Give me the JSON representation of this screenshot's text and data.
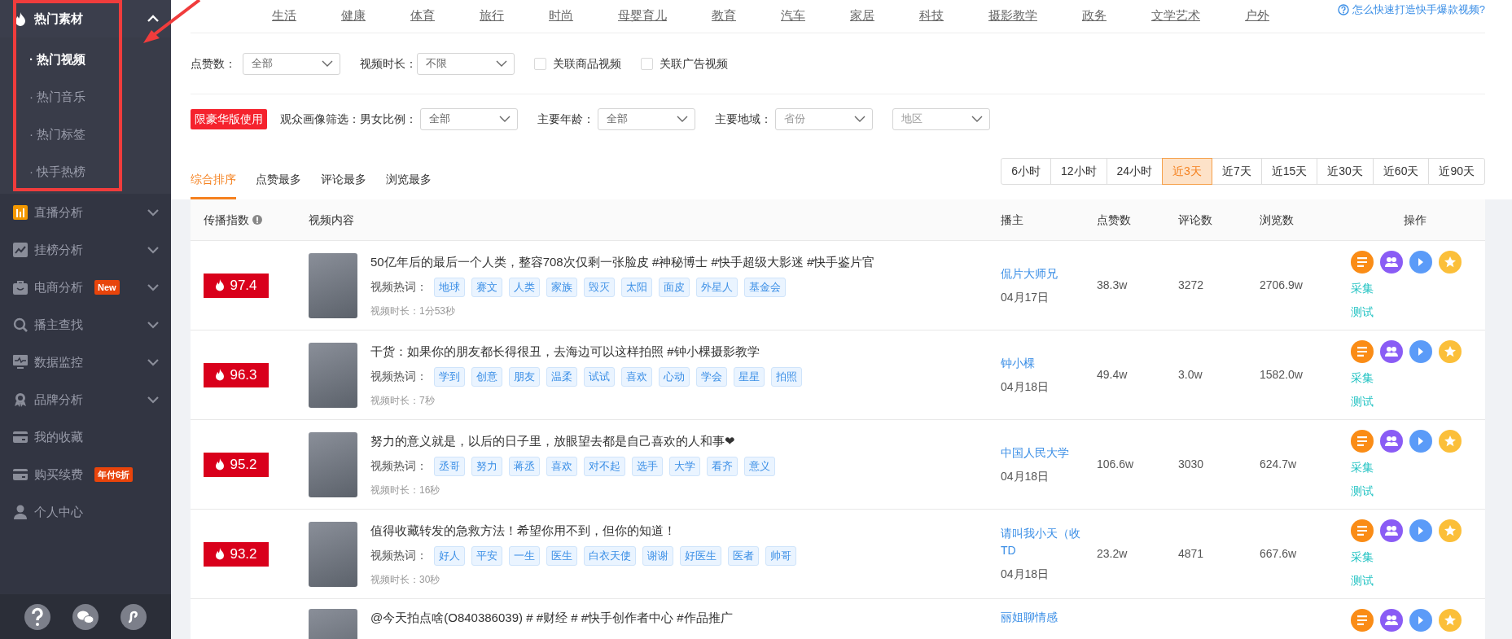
{
  "sidebar": {
    "items": [
      {
        "label": "热门素材",
        "expanded": true,
        "children": [
          {
            "label": "· 热门视频",
            "selected": true
          },
          {
            "label": "· 热门音乐",
            "selected": false
          },
          {
            "label": "· 热门标签",
            "selected": false
          },
          {
            "label": "· 快手热榜",
            "selected": false
          }
        ]
      },
      {
        "label": "直播分析",
        "expanded": false
      },
      {
        "label": "挂榜分析",
        "expanded": false
      },
      {
        "label": "电商分析",
        "badge": "New",
        "expanded": false
      },
      {
        "label": "播主查找",
        "expanded": false
      },
      {
        "label": "数据监控",
        "expanded": false
      },
      {
        "label": "品牌分析",
        "expanded": false
      },
      {
        "label": "我的收藏"
      },
      {
        "label": "购买续费",
        "badge": "年付6折"
      },
      {
        "label": "个人中心"
      }
    ]
  },
  "categories": [
    "生活",
    "健康",
    "体育",
    "旅行",
    "时尚",
    "母婴育儿",
    "教育",
    "汽车",
    "家居",
    "科技",
    "摄影教学",
    "政务",
    "文学艺术",
    "户外"
  ],
  "help_link": "怎么快速打造快手爆款视频?",
  "filters": {
    "likes": {
      "label": "点赞数：",
      "value": "全部"
    },
    "duration": {
      "label": "视频时长：",
      "value": "不限"
    },
    "checkboxes": [
      {
        "label": "关联商品视频",
        "checked": false
      },
      {
        "label": "关联广告视频",
        "checked": false
      }
    ]
  },
  "audience": {
    "badge": "限豪华版使用",
    "label": "观众画像筛选：",
    "selects": [
      {
        "label": "男女比例：",
        "value": "全部"
      },
      {
        "label": "主要年龄：",
        "value": "全部"
      },
      {
        "label": "主要地域：",
        "placeholder": "省份"
      },
      {
        "placeholder": "地区"
      }
    ]
  },
  "sort_tabs": [
    {
      "label": "综合排序",
      "selected": true
    },
    {
      "label": "点赞最多",
      "selected": false
    },
    {
      "label": "评论最多",
      "selected": false
    },
    {
      "label": "浏览最多",
      "selected": false
    }
  ],
  "time_ranges": [
    {
      "label": "6小时",
      "selected": false
    },
    {
      "label": "12小时",
      "selected": false
    },
    {
      "label": "24小时",
      "selected": false
    },
    {
      "label": "近3天",
      "selected": true
    },
    {
      "label": "近7天",
      "selected": false
    },
    {
      "label": "近15天",
      "selected": false
    },
    {
      "label": "近30天",
      "selected": false
    },
    {
      "label": "近60天",
      "selected": false
    },
    {
      "label": "近90天",
      "selected": false
    }
  ],
  "table": {
    "columns": [
      "传播指数",
      "视频内容",
      "播主",
      "点赞数",
      "评论数",
      "浏览数",
      "操作"
    ],
    "rows": [
      {
        "score": "97.4",
        "title": "50亿年后的最后一个人类，整容708次仅剩一张脸皮 #神秘博士 #快手超级大影迷 #快手鉴片官",
        "keywords_label": "视频热词：",
        "keywords": [
          "地球",
          "赛文",
          "人类",
          "家族",
          "毁灭",
          "太阳",
          "面皮",
          "外星人",
          "基金会"
        ],
        "duration": "视频时长：1分53秒",
        "author": "侃片大师兄",
        "date": "04月17日",
        "likes": "38.3w",
        "comments": "3272",
        "views": "2706.9w",
        "links": [
          "采集",
          "测试"
        ]
      },
      {
        "score": "96.3",
        "title": "干货：如果你的朋友都长得很丑，去海边可以这样拍照 #钟小棵摄影教学",
        "keywords_label": "视频热词：",
        "keywords": [
          "学到",
          "创意",
          "朋友",
          "温柔",
          "试试",
          "喜欢",
          "心动",
          "学会",
          "星星",
          "拍照"
        ],
        "duration": "视频时长：7秒",
        "author": "钟小棵",
        "date": "04月18日",
        "likes": "49.4w",
        "comments": "3.0w",
        "views": "1582.0w",
        "links": [
          "采集",
          "测试"
        ]
      },
      {
        "score": "95.2",
        "title": "努力的意义就是，以后的日子里，放眼望去都是自己喜欢的人和事❤",
        "keywords_label": "视频热词：",
        "keywords": [
          "丞哥",
          "努力",
          "蒋丞",
          "喜欢",
          "对不起",
          "选手",
          "大学",
          "看齐",
          "意义"
        ],
        "duration": "视频时长：16秒",
        "author": "中国人民大学",
        "date": "04月18日",
        "likes": "106.6w",
        "comments": "3030",
        "views": "624.7w",
        "links": [
          "采集",
          "测试"
        ]
      },
      {
        "score": "93.2",
        "title": "值得收藏转发的急救方法！希望你用不到，但你的知道！",
        "keywords_label": "视频热词：",
        "keywords": [
          "好人",
          "平安",
          "一生",
          "医生",
          "白衣天使",
          "谢谢",
          "好医生",
          "医者",
          "帅哥"
        ],
        "duration": "视频时长：30秒",
        "author": "请叫我小天（收TD",
        "date": "04月18日",
        "likes": "23.2w",
        "comments": "4871",
        "views": "667.6w",
        "links": [
          "采集",
          "测试"
        ]
      },
      {
        "title": "@今天拍点啥(O840386039) # #财经 # #快手创作者中心 #作品推广",
        "author": "丽姐聊情感"
      }
    ]
  }
}
